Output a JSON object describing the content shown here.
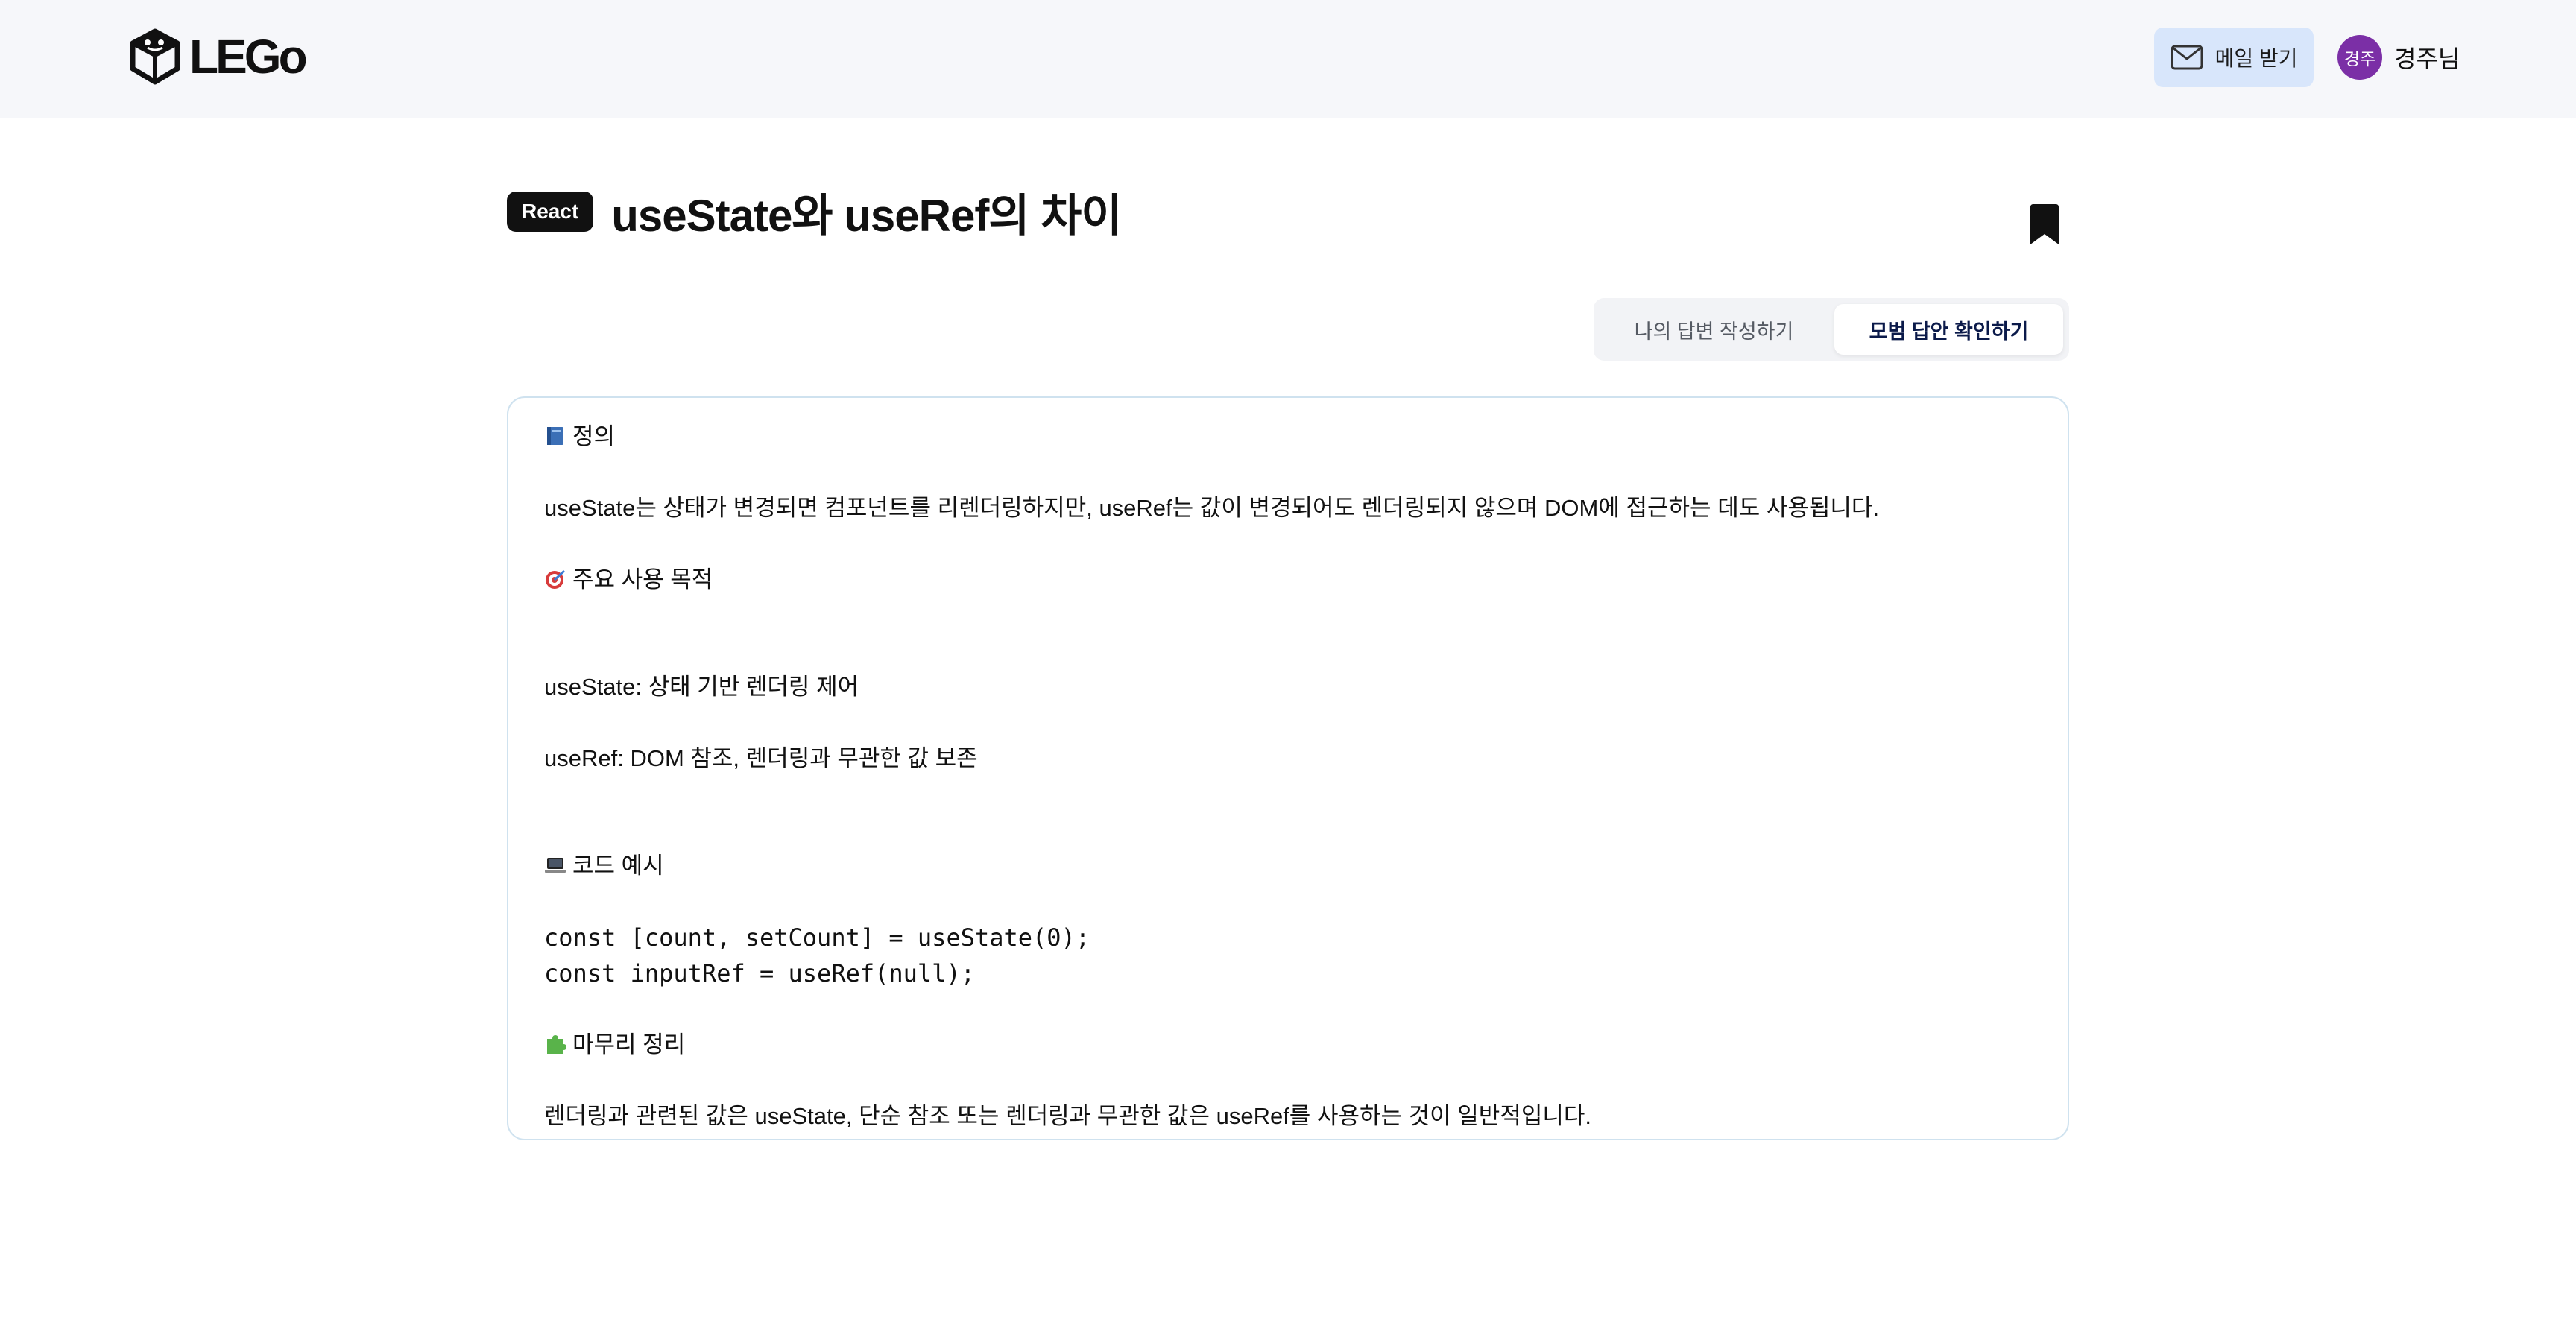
{
  "header": {
    "logo_text": "LEGo",
    "mail_button_label": "메일 받기",
    "user": {
      "avatar_text": "경주",
      "name": "경주님"
    }
  },
  "question": {
    "category_tag": "React",
    "title": "useState와 useRef의 차이"
  },
  "tabs": [
    {
      "label": "나의 답변 작성하기",
      "active": false
    },
    {
      "label": "모범 답안 확인하기",
      "active": true
    }
  ],
  "answer": {
    "definition_heading": "정의",
    "definition_text": "useState는 상태가 변경되면 컴포넌트를 리렌더링하지만, useRef는 값이 변경되어도 렌더링되지 않으며 DOM에 접근하는 데도 사용됩니다.",
    "purpose_heading": "주요 사용 목적",
    "purpose_items": [
      "useState: 상태 기반 렌더링 제어",
      "useRef: DOM 참조, 렌더링과 무관한 값 보존"
    ],
    "code_heading": "코드 예시",
    "code_lines": [
      "const [count, setCount] = useState(0);",
      "const inputRef = useRef(null);"
    ],
    "summary_heading": "마무리 정리",
    "summary_text": "렌더링과 관련된 값은 useState, 단순 참조 또는 렌더링과 무관한 값은 useRef를 사용하는 것이 일반적입니다."
  },
  "icons": {
    "definition": "book-icon",
    "purpose": "target-icon",
    "code": "laptop-icon",
    "summary": "puzzle-icon",
    "mail": "envelope-icon",
    "bookmark": "bookmark-icon"
  },
  "colors": {
    "header_bg": "#f6f7fa",
    "mail_button_bg": "#d8e6fb",
    "avatar_bg": "#7b2fa6",
    "card_border": "#cfe2ef",
    "active_tab_text": "#0b1a4a"
  }
}
